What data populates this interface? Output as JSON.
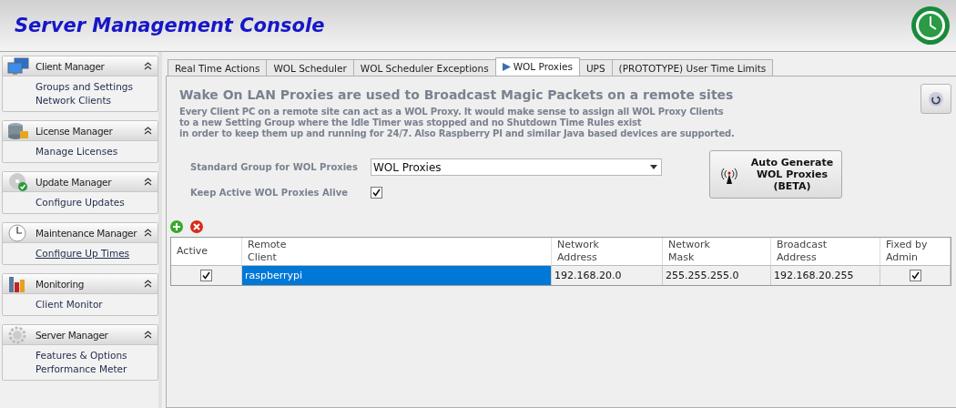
{
  "header": {
    "title": "Server Management Console"
  },
  "sidebar": {
    "groups": [
      {
        "title": "Client Manager",
        "expanded": true,
        "items": [
          {
            "label": "Groups and Settings",
            "selected": false
          },
          {
            "label": "Network Clients",
            "selected": false
          }
        ]
      },
      {
        "title": "License Manager",
        "expanded": true,
        "items": [
          {
            "label": "Manage Licenses",
            "selected": false
          }
        ]
      },
      {
        "title": "Update  Manager",
        "expanded": true,
        "items": [
          {
            "label": "Configure Updates",
            "selected": false
          }
        ]
      },
      {
        "title": "Maintenance Manager",
        "expanded": true,
        "items": [
          {
            "label": "Configure Up Times",
            "selected": true
          }
        ]
      },
      {
        "title": "Monitoring",
        "expanded": true,
        "items": [
          {
            "label": "Client Monitor",
            "selected": false
          }
        ]
      },
      {
        "title": "Server Manager",
        "expanded": true,
        "items": [
          {
            "label": "Features & Options",
            "selected": false
          },
          {
            "label": "Performance Meter",
            "selected": false
          }
        ]
      }
    ]
  },
  "tabs": [
    {
      "label": "Real Time Actions",
      "selected": false
    },
    {
      "label": "WOL Scheduler",
      "selected": false
    },
    {
      "label": "WOL Scheduler Exceptions",
      "selected": false
    },
    {
      "label": "WOL Proxies",
      "selected": true
    },
    {
      "label": "UPS",
      "selected": false
    },
    {
      "label": "(PROTOTYPE) User Time Limits",
      "selected": false
    }
  ],
  "panel": {
    "headline": "Wake On LAN Proxies are used to Broadcast Magic Packets on a remote sites",
    "description": [
      "Every Client PC on a remote site can act as a WOL Proxy. It would make sense to assign all WOL Proxy Clients",
      "to a new Setting Group where the Idle Timer was stopped and no Shutdown Time Rules exist",
      "in order to keep them up and running for 24/7. Also Raspberry PI and similar Java based devices are supported."
    ],
    "group_label": "Standard Group for WOL Proxies",
    "group_value": "WOL Proxies",
    "keep_alive_label": "Keep Active WOL Proxies Alive",
    "keep_alive_checked": true,
    "auto_button": "Auto Generate\nWOL Proxies\n(BETA)"
  },
  "table": {
    "columns": [
      "Active",
      "Remote\nClient",
      "Network\nAddress",
      "Network\nMask",
      "Broadcast\nAddress",
      "Fixed by\nAdmin"
    ],
    "rows": [
      {
        "active": true,
        "remote_client": "raspberrypi",
        "network_address": "192.168.20.0",
        "network_mask": "255.255.255.0",
        "broadcast_address": "192.168.20.255",
        "fixed_by_admin": true,
        "selected": true
      }
    ]
  }
}
